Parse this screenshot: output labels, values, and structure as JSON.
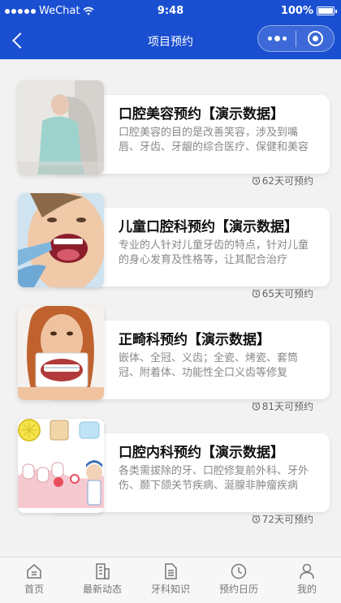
{
  "status_bar": {
    "carrier": "WeChat",
    "time": "9:48",
    "battery": "100%"
  },
  "navbar": {
    "title": "项目预约"
  },
  "cards": [
    {
      "title": "口腔美容预约【演示数据】",
      "desc": "口腔美容的目的是改善笑容，涉及到嘴唇、牙齿、牙龈的综合医疗、保健和美容",
      "meta": "62天可预约"
    },
    {
      "title": "儿童口腔科预约【演示数据】",
      "desc": "专业的人针对儿童牙齿的特点，针对儿童的身心发育及性格等，让其配合治疗",
      "meta": "65天可预约"
    },
    {
      "title": "正畸科预约【演示数据】",
      "desc": "嵌体、全冠、义齿；全瓷、烤瓷、套筒冠、附着体、功能性全口义齿等修复",
      "meta": "81天可预约"
    },
    {
      "title": "口腔内科预约【演示数据】",
      "desc": "各类需拔除的牙、口腔修复前外科、牙外伤、颞下颌关节疾病、涎腺非肿瘤疾病",
      "meta": "72天可预约"
    }
  ],
  "tabs": [
    {
      "label": "首页",
      "icon": "home-icon"
    },
    {
      "label": "最新动态",
      "icon": "news-icon"
    },
    {
      "label": "牙科知识",
      "icon": "document-icon"
    },
    {
      "label": "预约日历",
      "icon": "clock-icon"
    },
    {
      "label": "我的",
      "icon": "user-icon"
    }
  ],
  "colors": {
    "brand": "#1a4fd1"
  }
}
